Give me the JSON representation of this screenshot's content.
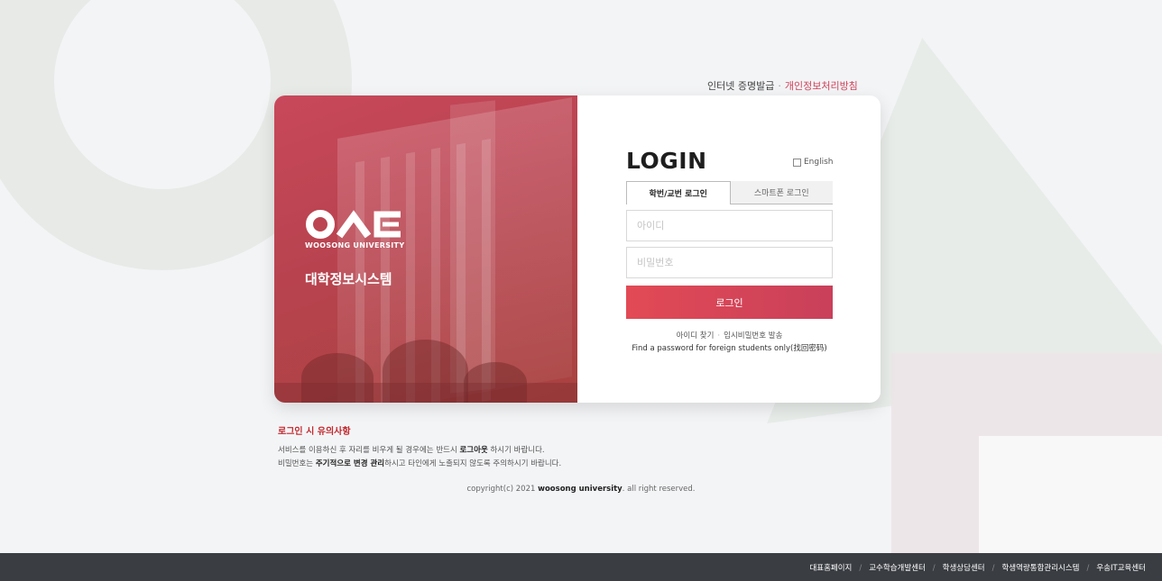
{
  "top_links": {
    "certificate": "인터넷 증명발급",
    "separator": "·",
    "privacy": "개인정보처리방침"
  },
  "branding": {
    "university_name": "WOOSONG UNIVERSITY",
    "system_name": "대학정보시스템"
  },
  "login": {
    "title": "LOGIN",
    "language_toggle": "English",
    "tabs": [
      {
        "label": "학번/교번 로그인",
        "active": true
      },
      {
        "label": "스마트폰 로그인",
        "active": false
      }
    ],
    "id_field": {
      "value": "",
      "placeholder": "아이디"
    },
    "password_field": {
      "value": "",
      "placeholder": "비밀번호"
    },
    "submit_label": "로그인",
    "find_id": "아이디 찾기",
    "link_separator": "·",
    "temp_password": "임시비밀번호 발송",
    "foreign_password": "Find a password for foreign students only(找回密码)"
  },
  "notice": {
    "title": "로그인 시 유의사항",
    "line1_pre": "서비스를 이용하신 후 자리를 비우게 될 경우에는 반드시 ",
    "line1_bold": "로그아웃",
    "line1_post": " 하시기 바랍니다.",
    "line2_pre": "비밀번호는 ",
    "line2_bold": "주기적으로 변경 관리",
    "line2_post": "하시고 타인에게 노출되지 않도록 주의하시기 바랍니다."
  },
  "copyright": {
    "pre": "copyright(c) 2021 ",
    "bold": "woosong university",
    "post": ". all right reserved."
  },
  "footer": {
    "separator": "/",
    "links": [
      "대표홈페이지",
      "교수학습개발센터",
      "학생상담센터",
      "학생역량통합관리시스템",
      "우송IT교육센터"
    ]
  },
  "colors": {
    "accent": "#d0425a",
    "button_start": "#e24a55",
    "button_end": "#c9405a",
    "notice_title": "#c2272d",
    "footer_bg": "#3a3d42"
  }
}
